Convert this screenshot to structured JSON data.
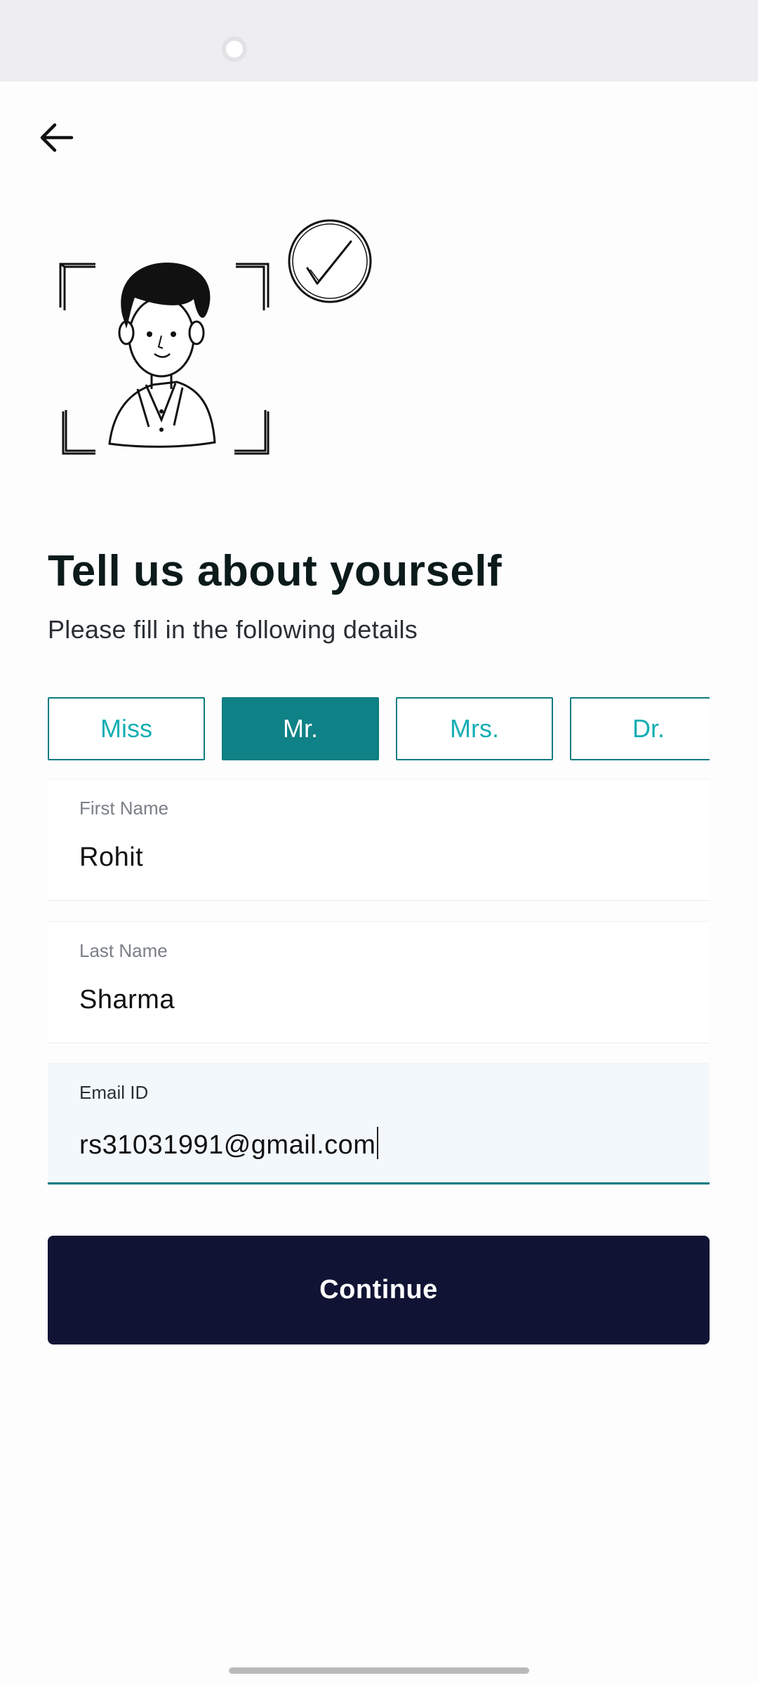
{
  "header": {
    "back_icon": "arrow-left-icon"
  },
  "illustration": {
    "icons": [
      "person-illustration",
      "check-circle-icon",
      "scan-frame-icon"
    ]
  },
  "form": {
    "title": "Tell us about yourself",
    "subtitle": "Please fill in the following details",
    "salutations": [
      {
        "label": "Miss",
        "selected": false
      },
      {
        "label": "Mr.",
        "selected": true
      },
      {
        "label": "Mrs.",
        "selected": false
      },
      {
        "label": "Dr.",
        "selected": false
      }
    ],
    "first_name": {
      "label": "First Name",
      "value": "Rohit"
    },
    "last_name": {
      "label": "Last Name",
      "value": "Sharma"
    },
    "email": {
      "label": "Email ID",
      "value": "rs31031991@gmail.com"
    }
  },
  "actions": {
    "continue_label": "Continue"
  },
  "colors": {
    "accent": "#0e8286",
    "accent_text": "#13aeb3",
    "primary_button": "#111334"
  }
}
